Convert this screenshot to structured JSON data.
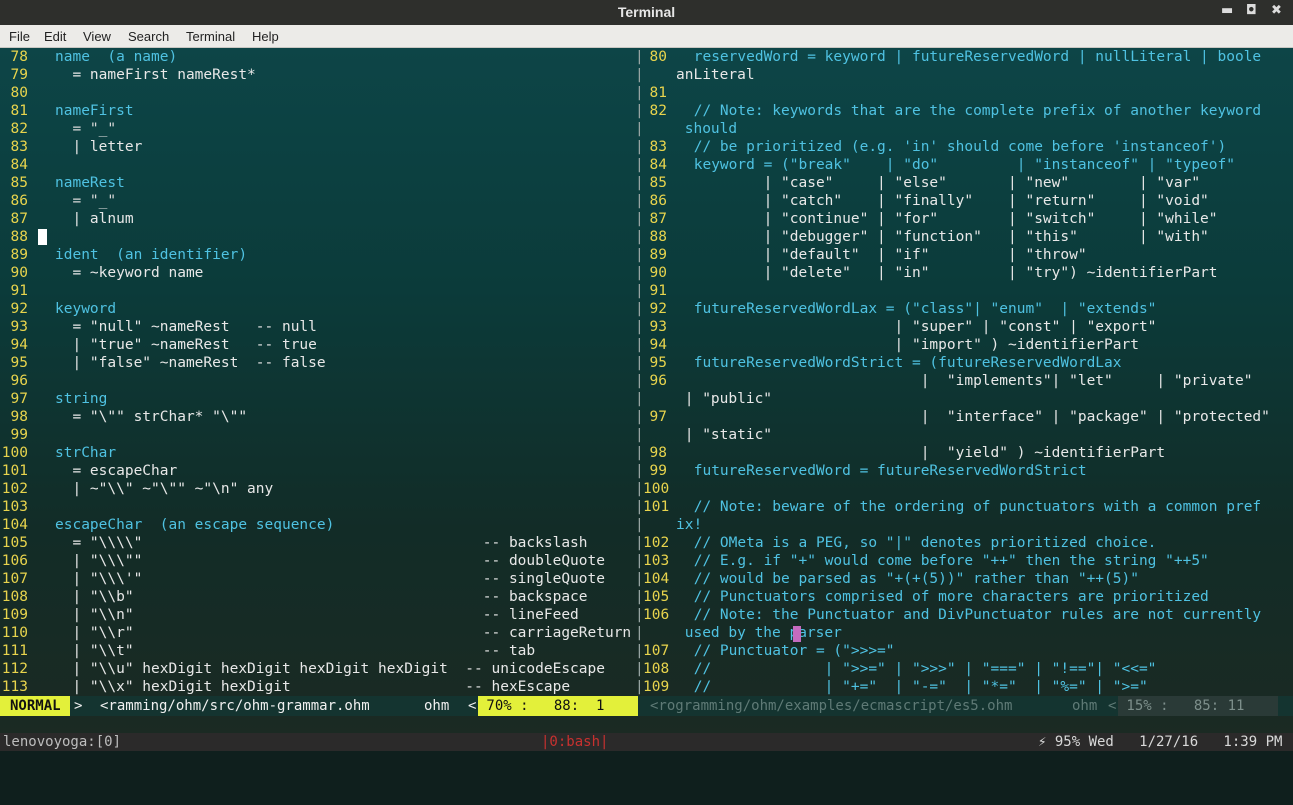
{
  "window": {
    "title": "Terminal"
  },
  "menu": [
    "File",
    "Edit",
    "View",
    "Search",
    "Terminal",
    "Help"
  ],
  "left_pane": {
    "lines": [
      {
        "n": "78",
        "t": "name  (a name)",
        "k": "def"
      },
      {
        "n": "79",
        "t": "  = nameFirst nameRest*",
        "k": "txt"
      },
      {
        "n": "80",
        "t": "",
        "k": "txt"
      },
      {
        "n": "81",
        "t": "nameFirst",
        "k": "def"
      },
      {
        "n": "82",
        "t": "  = \"_\"",
        "k": "str"
      },
      {
        "n": "83",
        "t": "  | letter",
        "k": "txt"
      },
      {
        "n": "84",
        "t": "",
        "k": "txt"
      },
      {
        "n": "85",
        "t": "nameRest",
        "k": "def"
      },
      {
        "n": "86",
        "t": "  = \"_\"",
        "k": "str"
      },
      {
        "n": "87",
        "t": "  | alnum",
        "k": "txt"
      },
      {
        "n": "88",
        "t": "",
        "k": "txt"
      },
      {
        "n": "89",
        "t": "ident  (an identifier)",
        "k": "def"
      },
      {
        "n": "90",
        "t": "  = ~keyword name",
        "k": "txt"
      },
      {
        "n": "91",
        "t": "",
        "k": "txt"
      },
      {
        "n": "92",
        "t": "keyword",
        "k": "def"
      },
      {
        "n": "93",
        "t": "  = \"null\" ~nameRest   -- null",
        "k": "txt"
      },
      {
        "n": "94",
        "t": "  | \"true\" ~nameRest   -- true",
        "k": "txt"
      },
      {
        "n": "95",
        "t": "  | \"false\" ~nameRest  -- false",
        "k": "txt"
      },
      {
        "n": "96",
        "t": "",
        "k": "txt"
      },
      {
        "n": "97",
        "t": "string",
        "k": "def"
      },
      {
        "n": "98",
        "t": "  = \"\\\"\" strChar* \"\\\"\"",
        "k": "txt"
      },
      {
        "n": "99",
        "t": "",
        "k": "txt"
      },
      {
        "n": "100",
        "t": "strChar",
        "k": "def"
      },
      {
        "n": "101",
        "t": "  = escapeChar",
        "k": "txt"
      },
      {
        "n": "102",
        "t": "  | ~\"\\\\\" ~\"\\\"\" ~\"\\n\" any",
        "k": "txt"
      },
      {
        "n": "103",
        "t": "",
        "k": "txt"
      },
      {
        "n": "104",
        "t": "escapeChar  (an escape sequence)",
        "k": "def"
      },
      {
        "n": "105",
        "t": "  = \"\\\\\\\\\"                                       -- backslash",
        "k": "txt"
      },
      {
        "n": "106",
        "t": "  | \"\\\\\\\"\"                                       -- doubleQuote",
        "k": "txt"
      },
      {
        "n": "107",
        "t": "  | \"\\\\\\'\"                                       -- singleQuote",
        "k": "txt"
      },
      {
        "n": "108",
        "t": "  | \"\\\\b\"                                        -- backspace",
        "k": "txt"
      },
      {
        "n": "109",
        "t": "  | \"\\\\n\"                                        -- lineFeed",
        "k": "txt"
      },
      {
        "n": "110",
        "t": "  | \"\\\\r\"                                        -- carriageReturn",
        "k": "txt"
      },
      {
        "n": "111",
        "t": "  | \"\\\\t\"                                        -- tab",
        "k": "txt"
      },
      {
        "n": "112",
        "t": "  | \"\\\\u\" hexDigit hexDigit hexDigit hexDigit  -- unicodeEscape",
        "k": "txt"
      },
      {
        "n": "113",
        "t": "  | \"\\\\x\" hexDigit hexDigit                    -- hexEscape",
        "k": "txt"
      }
    ]
  },
  "right_pane": {
    "lines": [
      {
        "n": "80",
        "t": " reservedWord = keyword | futureReservedWord | nullLiteral | boole",
        "k": "def"
      },
      {
        "n": "",
        "t": "anLiteral",
        "k": "txt",
        "wrap": true
      },
      {
        "n": "81",
        "t": "",
        "k": "txt"
      },
      {
        "n": "82",
        "t": " // Note: keywords that are the complete prefix of another keyword",
        "k": "cmt"
      },
      {
        "n": "",
        "t": " should",
        "k": "cmt",
        "wrap": true
      },
      {
        "n": "83",
        "t": " // be prioritized (e.g. 'in' should come before 'instanceof')",
        "k": "cmt"
      },
      {
        "n": "83b",
        "t": " keyword = (\"break\"    | \"do\"         | \"instanceof\" | \"typeof\"",
        "k": "def",
        "shown": "84"
      },
      {
        "n": "85",
        "t": "         | \"case\"     | \"else\"       | \"new\"        | \"var\"",
        "k": "txt"
      },
      {
        "n": "86",
        "t": "         | \"catch\"    | \"finally\"    | \"return\"     | \"void\"",
        "k": "txt"
      },
      {
        "n": "87",
        "t": "         | \"continue\" | \"for\"        | \"switch\"     | \"while\"",
        "k": "txt"
      },
      {
        "n": "88",
        "t": "         | \"debugger\" | \"function\"   | \"this\"       | \"with\"",
        "k": "txt"
      },
      {
        "n": "89",
        "t": "         | \"default\"  | \"if\"         | \"throw\"",
        "k": "txt"
      },
      {
        "n": "90",
        "t": "         | \"delete\"   | \"in\"         | \"try\") ~identifierPart",
        "k": "txt"
      },
      {
        "n": "91",
        "t": "",
        "k": "txt"
      },
      {
        "n": "92",
        "t": " futureReservedWordLax = (\"class\"| \"enum\"  | \"extends\"",
        "k": "def"
      },
      {
        "n": "93",
        "t": "                        | \"super\" | \"const\" | \"export\"",
        "k": "txt"
      },
      {
        "n": "94",
        "t": "                        | \"import\" ) ~identifierPart",
        "k": "txt"
      },
      {
        "n": "95",
        "t": " futureReservedWordStrict = (futureReservedWordLax",
        "k": "def"
      },
      {
        "n": "96",
        "t": "                           |  \"implements\"| \"let\"     | \"private\"",
        "k": "txt"
      },
      {
        "n": "",
        "t": " | \"public\"",
        "k": "txt",
        "wrap": true
      },
      {
        "n": "97",
        "t": "                           |  \"interface\" | \"package\" | \"protected\"",
        "k": "txt"
      },
      {
        "n": "",
        "t": " | \"static\"",
        "k": "txt",
        "wrap": true
      },
      {
        "n": "98",
        "t": "                           |  \"yield\" ) ~identifierPart",
        "k": "txt"
      },
      {
        "n": "99",
        "t": " futureReservedWord = futureReservedWordStrict",
        "k": "def"
      },
      {
        "n": "100",
        "t": "",
        "k": "txt"
      },
      {
        "n": "101",
        "t": " // Note: beware of the ordering of punctuators with a common pref",
        "k": "cmt"
      },
      {
        "n": "",
        "t": "ix!",
        "k": "cmt",
        "wrap": true
      },
      {
        "n": "102",
        "t": " // OMeta is a PEG, so \"|\" denotes prioritized choice.",
        "k": "cmt"
      },
      {
        "n": "103",
        "t": " // E.g. if \"+\" would come before \"++\" then the string \"++5\"",
        "k": "cmt"
      },
      {
        "n": "104",
        "t": " // would be parsed as \"+(+(5))\" rather than \"++(5)\"",
        "k": "cmt"
      },
      {
        "n": "105",
        "t": " // Punctuators comprised of more characters are prioritized",
        "k": "cmt"
      },
      {
        "n": "106",
        "t": " // Note: the Punctuator and DivPunctuator rules are not currently",
        "k": "cmt"
      },
      {
        "n": "",
        "t": " used by the parser",
        "k": "cmt",
        "wrap": true
      },
      {
        "n": "107",
        "t": " // Punctuator = (\">>>=\"",
        "k": "cmt"
      },
      {
        "n": "108",
        "t": " //             | \">>=\" | \">>>\" | \"===\" | \"!==\"| \"<<=\"",
        "k": "cmt"
      },
      {
        "n": "109",
        "t": " //             | \"+=\"  | \"-=\"  | \"*=\"  | \"%=\" | \">=\"",
        "k": "cmt"
      }
    ]
  },
  "statusline": {
    "mode": "NORMAL",
    "left_arrow": ">",
    "left_file": "<ramming/ohm/src/ohm-grammar.ohm",
    "left_ft": "ohm",
    "left_sep": "<",
    "left_pos": " 70% :   88:  1 ",
    "right_file": "<rogramming/ohm/examples/ecmascript/es5.ohm",
    "right_ft": "ohm",
    "right_sep": "<",
    "right_pos": " 15% :   85: 11 "
  },
  "tmux": {
    "session": "lenovoyoga:[0]",
    "window": "|0:bash|",
    "right": "⚡ 95% Wed   1/27/16   1:39 PM"
  },
  "colors": {
    "mode_bg": "#e3f03a",
    "linenr": "#e8d44d",
    "keyword": "#4fc2e2"
  }
}
